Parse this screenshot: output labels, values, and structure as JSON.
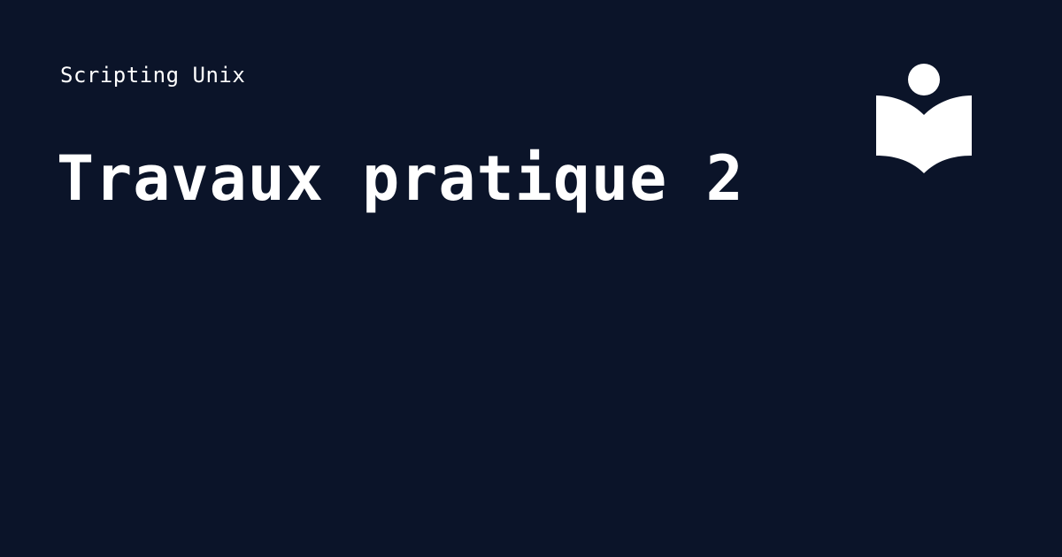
{
  "header": {
    "subtitle": "Scripting Unix",
    "title": "Travaux pratique 2"
  },
  "logo": {
    "icon": "reader-book-icon",
    "color": "#ffffff"
  },
  "colors": {
    "background": "#0b1429",
    "text": "#ffffff"
  }
}
